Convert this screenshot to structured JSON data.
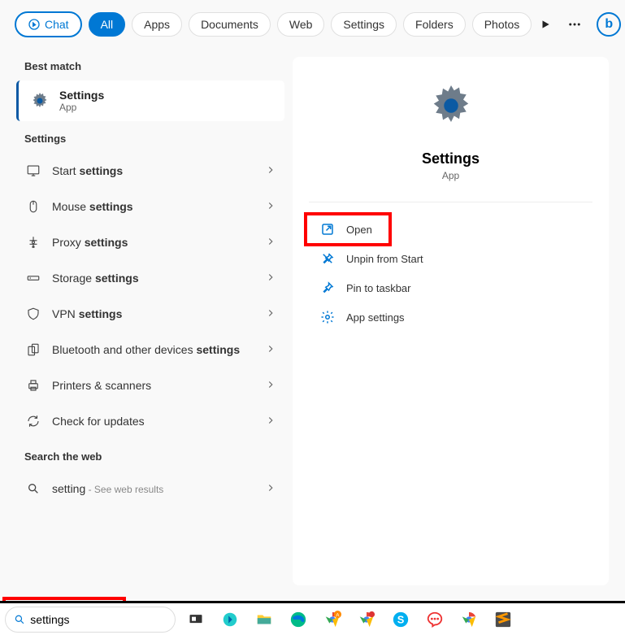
{
  "tabs": {
    "chat": "Chat",
    "all": "All",
    "items": [
      "Apps",
      "Documents",
      "Web",
      "Settings",
      "Folders",
      "Photos"
    ]
  },
  "sections": {
    "best_match": "Best match",
    "settings": "Settings",
    "search_web": "Search the web"
  },
  "best_match": {
    "title": "Settings",
    "subtitle": "App"
  },
  "settings_list": [
    {
      "icon": "display",
      "prefix": "Start ",
      "bold": "settings"
    },
    {
      "icon": "mouse",
      "prefix": "Mouse ",
      "bold": "settings"
    },
    {
      "icon": "proxy",
      "prefix": "Proxy ",
      "bold": "settings"
    },
    {
      "icon": "storage",
      "prefix": "Storage ",
      "bold": "settings"
    },
    {
      "icon": "vpn",
      "prefix": "VPN ",
      "bold": "settings"
    },
    {
      "icon": "bluetooth",
      "prefix": "Bluetooth and other devices ",
      "bold": "settings"
    },
    {
      "icon": "printer",
      "prefix": "Printers & scanners",
      "bold": ""
    },
    {
      "icon": "updates",
      "prefix": "Check for updates",
      "bold": ""
    }
  ],
  "web_search": {
    "prefix": "setting",
    "suffix": " - See web results"
  },
  "preview": {
    "title": "Settings",
    "subtitle": "App",
    "actions": [
      {
        "icon": "open",
        "label": "Open"
      },
      {
        "icon": "unpin",
        "label": "Unpin from Start"
      },
      {
        "icon": "pin-tb",
        "label": "Pin to taskbar"
      },
      {
        "icon": "app-settings",
        "label": "App settings"
      }
    ]
  },
  "search_input": {
    "value": "settings"
  },
  "colors": {
    "accent": "#0078d4",
    "highlight": "#ff0000"
  },
  "taskbar_icons": [
    "taskview",
    "copilot",
    "explorer",
    "edge",
    "chrome-badge",
    "chrome-dot",
    "skype",
    "messenger",
    "chrome",
    "sublime"
  ]
}
